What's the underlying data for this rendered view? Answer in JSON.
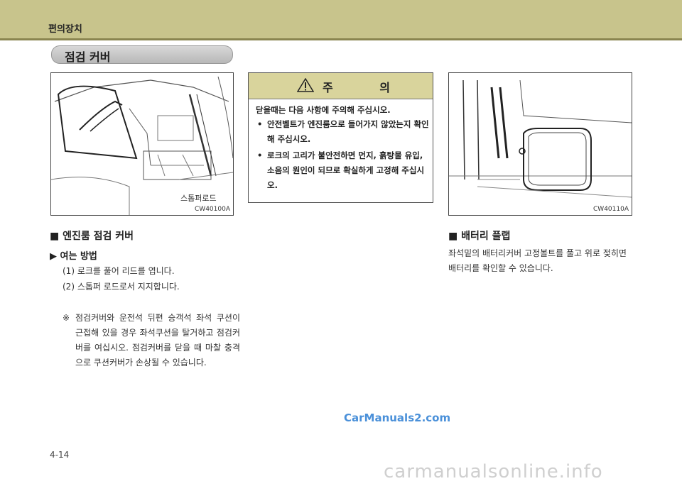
{
  "header": {
    "title": "편의장치"
  },
  "section": {
    "title": "점검 커버"
  },
  "figure_left": {
    "label": "스톱퍼로드",
    "code": "CW40100A"
  },
  "figure_right": {
    "code": "CW40110A"
  },
  "caution": {
    "title": "주 의",
    "lead": "닫을때는 다음 사항에 주의해 주십시오.",
    "items": [
      "안전벨트가 엔진룸으로 들어가지 않았는지 확인해 주십시오.",
      "로크의 고리가 불안전하면 먼지, 흙탕물 유입, 소음의 원인이 되므로 확실하게 고정해 주십시오."
    ]
  },
  "engine": {
    "heading": "■ 엔진룸 점검 커버",
    "subheading": "▶ 여는 방법",
    "steps": [
      "(1) 로크를 풀어 리드를 엽니다.",
      "(2) 스톱퍼 로드로서 지지합니다."
    ],
    "note_symbol": "※",
    "note": "점검커버와 운전석 뒤편 승객석 좌석 쿠션이 근접해 있을 경우 좌석쿠션을 탈거하고 점검커버를 여십시오. 점검커버를 닫을 때 마찰 충격으로 쿠션커버가 손상될 수 있습니다."
  },
  "battery": {
    "heading": "■ 배터리 플랩",
    "text": "좌석밑의 배터리커버 고정볼트를 풀고 위로 젖히면 배터리를 확인할 수 있습니다."
  },
  "watermark": "CarManuals2.com",
  "page_number": "4-14",
  "bottom_watermark": "carmanualsonline.info"
}
